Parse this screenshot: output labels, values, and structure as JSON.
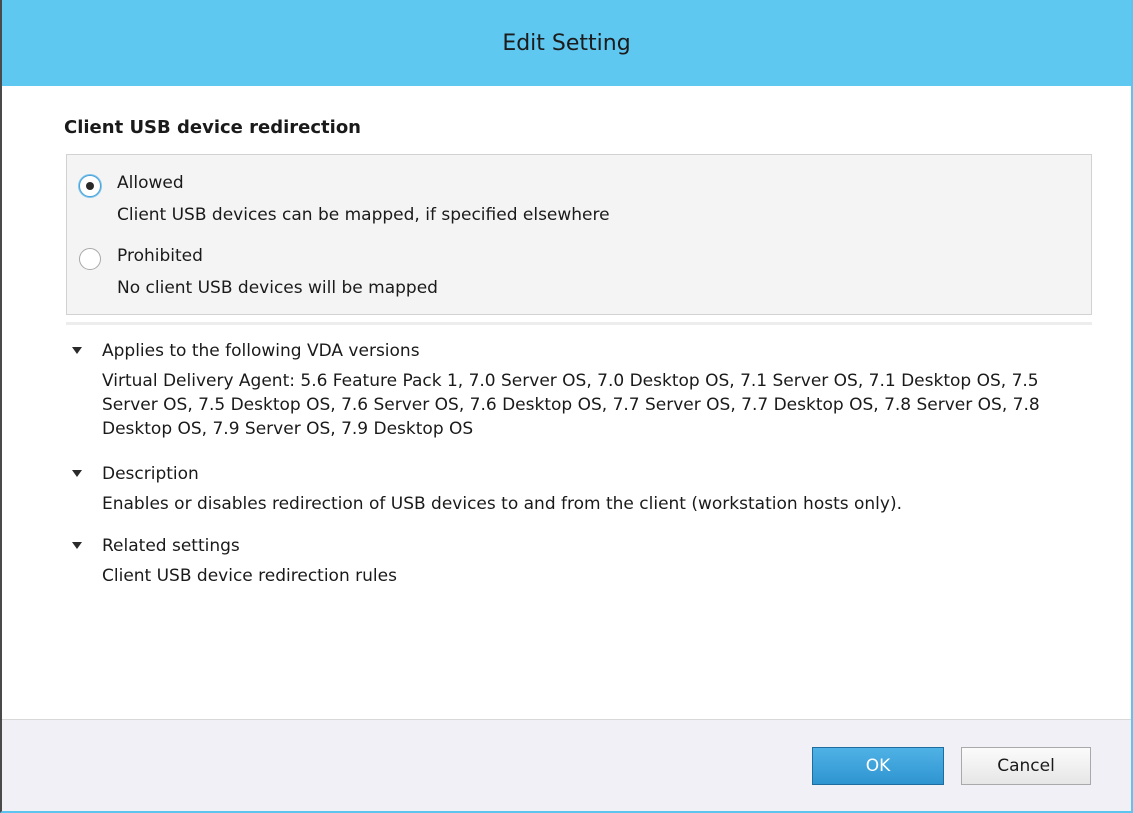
{
  "window": {
    "title": "Edit Setting"
  },
  "setting": {
    "name": "Client USB device redirection",
    "options": [
      {
        "label": "Allowed",
        "description": "Client USB devices can be mapped, if specified elsewhere",
        "selected": true
      },
      {
        "label": "Prohibited",
        "description": "No client USB devices will be mapped",
        "selected": false
      }
    ]
  },
  "sections": {
    "vda": {
      "title": "Applies to the following VDA versions",
      "body": "Virtual Delivery Agent: 5.6 Feature Pack 1, 7.0 Server OS, 7.0 Desktop OS, 7.1 Server OS, 7.1 Desktop OS, 7.5 Server OS, 7.5 Desktop OS, 7.6 Server OS, 7.6 Desktop OS, 7.7 Server OS, 7.7 Desktop OS, 7.8 Server OS, 7.8 Desktop OS, 7.9 Server OS, 7.9 Desktop OS",
      "expanded": true
    },
    "description": {
      "title": "Description",
      "body": "Enables or disables redirection of USB devices to and from the client (workstation hosts only).",
      "expanded": true
    },
    "related": {
      "title": "Related settings",
      "body": "Client USB device redirection rules",
      "expanded": true
    }
  },
  "buttons": {
    "ok": "OK",
    "cancel": "Cancel"
  },
  "icons": {
    "section_toggle": "caret-down-icon",
    "radio_selected": "radio-checked-icon",
    "radio_unselected": "radio-unchecked-icon"
  },
  "colors": {
    "titlebar": "#5ec8f0",
    "ok_button": "#2f95d0",
    "options_background": "#f4f4f4",
    "footer_background": "#f1f0f6"
  }
}
